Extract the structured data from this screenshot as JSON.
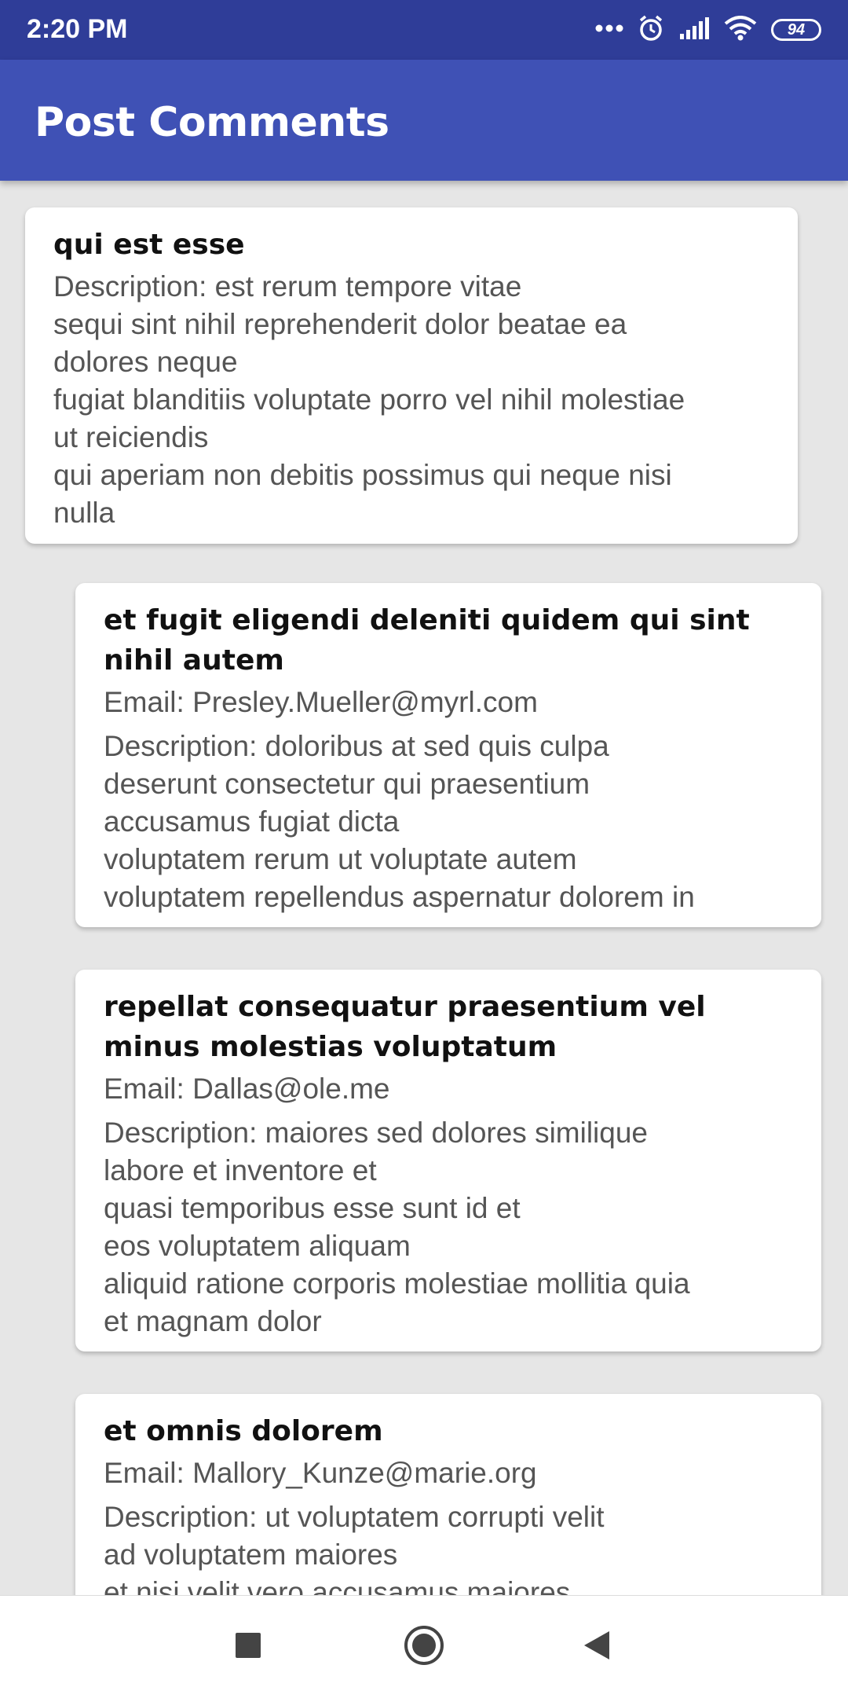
{
  "status_bar": {
    "time": "2:20 PM",
    "battery": "94",
    "icons": [
      "dots-icon",
      "alarm-icon",
      "signal-icon",
      "wifi-icon",
      "battery-icon"
    ]
  },
  "app_bar": {
    "title": "Post Comments"
  },
  "post": {
    "title": "qui est esse",
    "description": "Description: est rerum tempore vitae\nsequi sint nihil reprehenderit dolor beatae ea\ndolores neque\nfugiat blanditiis voluptate porro vel nihil molestiae\nut reiciendis\nqui aperiam non debitis possimus qui neque nisi\nnulla"
  },
  "comments": [
    {
      "title": "et fugit eligendi deleniti quidem qui sint nihil autem",
      "email": "Email: Presley.Mueller@myrl.com",
      "description": "Description: doloribus at sed quis culpa\ndeserunt consectetur qui praesentium\naccusamus fugiat dicta\nvoluptatem rerum ut voluptate autem\nvoluptatem repellendus aspernatur dolorem in"
    },
    {
      "title": "repellat consequatur praesentium vel minus molestias voluptatum",
      "email": "Email: Dallas@ole.me",
      "description": "Description: maiores sed dolores similique\nlabore et inventore et\nquasi temporibus esse sunt id et\neos voluptatem aliquam\naliquid ratione corporis molestiae mollitia quia\net magnam dolor"
    },
    {
      "title": "et omnis dolorem",
      "email": "Email: Mallory_Kunze@marie.org",
      "description": "Description: ut voluptatem corrupti velit\nad voluptatem maiores\net nisi velit vero accusamus maiores"
    }
  ],
  "nav": {
    "icons": [
      "recents-square-icon",
      "home-circle-icon",
      "back-triangle-icon"
    ]
  },
  "colors": {
    "status_bar": "#2f3d98",
    "app_bar": "#3f51b5",
    "background": "#e6e6e6"
  }
}
